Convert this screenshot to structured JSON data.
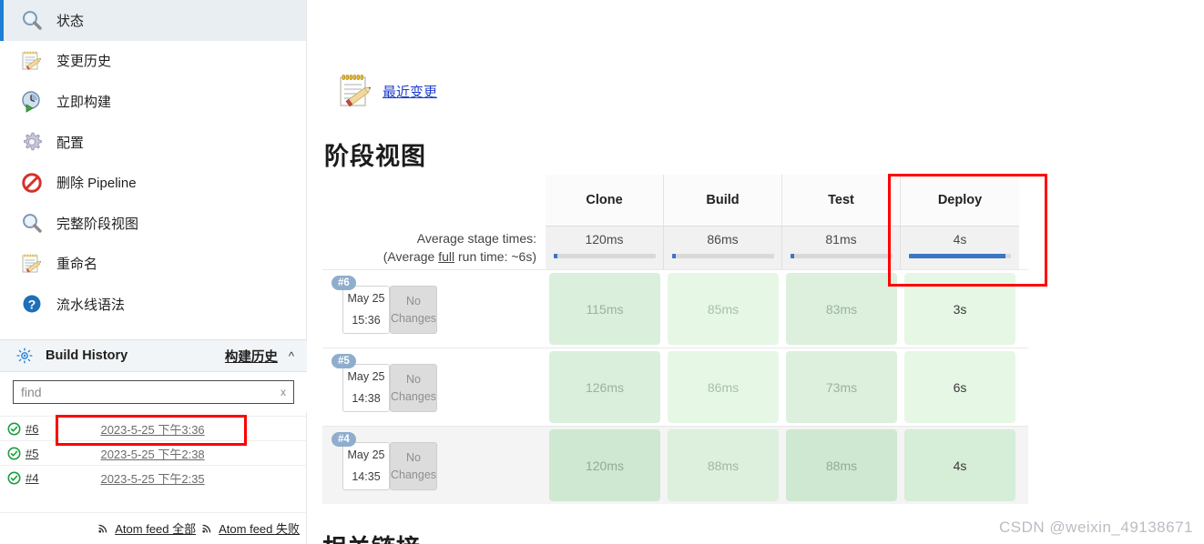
{
  "sidebar": {
    "items": [
      {
        "label": "状态",
        "icon": "magnifier-icon",
        "selected": true
      },
      {
        "label": "变更历史",
        "icon": "notepad-pencil-icon",
        "selected": false
      },
      {
        "label": "立即构建",
        "icon": "build-now-icon",
        "selected": false
      },
      {
        "label": "配置",
        "icon": "gear-icon",
        "selected": false
      },
      {
        "label": "删除 Pipeline",
        "icon": "delete-icon",
        "selected": false
      },
      {
        "label": "完整阶段视图",
        "icon": "magnifier-icon",
        "selected": false
      },
      {
        "label": "重命名",
        "icon": "notepad-pencil-icon",
        "selected": false
      },
      {
        "label": "流水线语法",
        "icon": "help-icon",
        "selected": false
      }
    ],
    "build_history": {
      "title": "Build History",
      "cn_label": "构建历史",
      "collapse_icon": "chevron-up-icon",
      "panel_icon": "sun-gear-icon",
      "search_placeholder": "find",
      "search_value": "",
      "clear_label": "x",
      "rows": [
        {
          "status_icon": "success-check-icon",
          "number": "#6",
          "date": "2023-5-25 下午3:36",
          "highlighted": true
        },
        {
          "status_icon": "success-check-icon",
          "number": "#5",
          "date": "2023-5-25 下午2:38",
          "highlighted": false
        },
        {
          "status_icon": "success-check-icon",
          "number": "#4",
          "date": "2023-5-25 下午2:35",
          "highlighted": false
        }
      ],
      "feeds": [
        {
          "icon": "rss-icon",
          "label": "Atom feed 全部"
        },
        {
          "icon": "rss-icon",
          "label": "Atom feed 失败"
        }
      ]
    }
  },
  "main": {
    "recent_changes": {
      "icon": "notepad-pencil-icon",
      "label": "最近变更"
    },
    "stage_view_title": "阶段视图",
    "bottom_heading": "相关链接",
    "watermark": "CSDN @weixin_49138671",
    "highlight_color": "#ff0000"
  },
  "chart_data": {
    "type": "table",
    "title": "阶段视图",
    "categories": [
      "Clone",
      "Build",
      "Test",
      "Deploy"
    ],
    "average_label_line1": "Average stage times:",
    "average_label_line2_pre": "(Average ",
    "average_label_line2_u": "full",
    "average_label_line2_post": " run time: ~6s)",
    "average_values": [
      "120ms",
      "86ms",
      "81ms",
      "4s"
    ],
    "average_bar_pct": [
      4,
      4,
      4,
      95
    ],
    "builds": [
      {
        "number": "#6",
        "date": "May 25",
        "time": "15:36",
        "changes": "No Changes",
        "alt_row": false,
        "stages": [
          {
            "value": "115ms",
            "bg": "#daf0dc",
            "fg": "#9ab39c"
          },
          {
            "value": "85ms",
            "bg": "#e6f7e6",
            "fg": "#a8c0a8"
          },
          {
            "value": "83ms",
            "bg": "#dcf0dd",
            "fg": "#9ab39c"
          },
          {
            "value": "3s",
            "bg": "#e6f7e6",
            "fg": "#3a3a3a"
          }
        ]
      },
      {
        "number": "#5",
        "date": "May 25",
        "time": "14:38",
        "changes": "No Changes",
        "alt_row": false,
        "stages": [
          {
            "value": "126ms",
            "bg": "#daf0dc",
            "fg": "#9ab39c"
          },
          {
            "value": "86ms",
            "bg": "#e6f7e6",
            "fg": "#a8c0a8"
          },
          {
            "value": "73ms",
            "bg": "#dcf0dd",
            "fg": "#9ab39c"
          },
          {
            "value": "6s",
            "bg": "#e6f7e6",
            "fg": "#3a3a3a"
          }
        ]
      },
      {
        "number": "#4",
        "date": "May 25",
        "time": "14:35",
        "changes": "No Changes",
        "alt_row": true,
        "stages": [
          {
            "value": "120ms",
            "bg": "#cfe8d1",
            "fg": "#94ab95"
          },
          {
            "value": "88ms",
            "bg": "#dcf0dd",
            "fg": "#a0b8a1"
          },
          {
            "value": "88ms",
            "bg": "#cfe8d1",
            "fg": "#94ab95"
          },
          {
            "value": "4s",
            "bg": "#d6edd8",
            "fg": "#3a3a3a"
          }
        ]
      }
    ]
  }
}
